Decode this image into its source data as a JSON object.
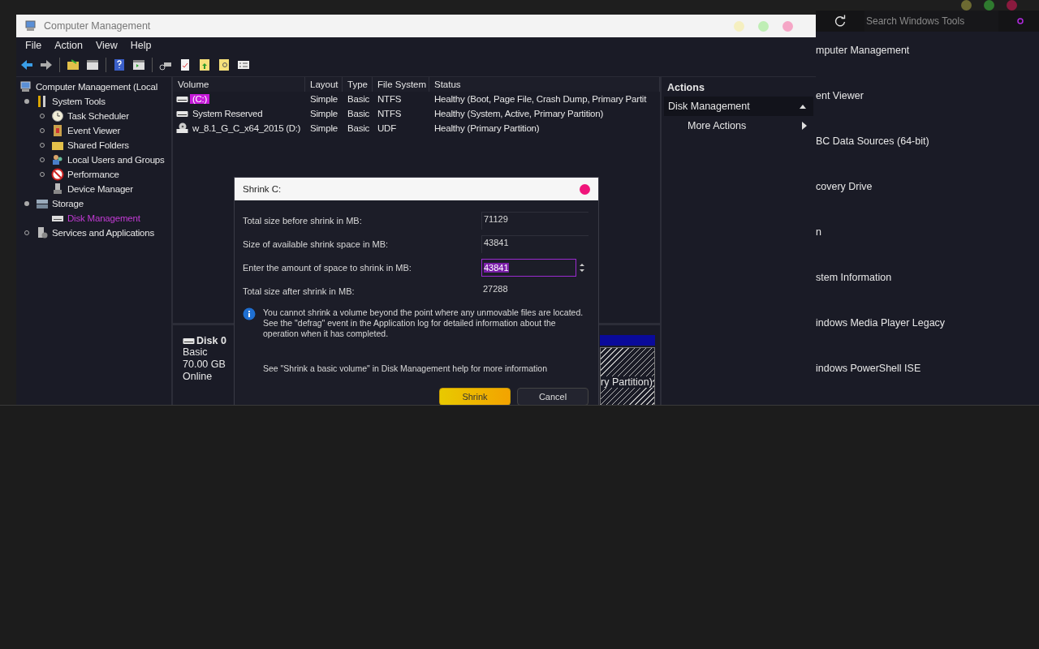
{
  "tools_window": {
    "search": {
      "placeholder": "Search Windows Tools"
    },
    "items": [
      "mputer Management",
      "ent Viewer",
      "BC Data Sources (64-bit)",
      "covery Drive",
      "n",
      "stem Information",
      "indows Media Player Legacy",
      "indows PowerShell ISE"
    ]
  },
  "window": {
    "title": "Computer Management"
  },
  "menu": [
    "File",
    "Action",
    "View",
    "Help"
  ],
  "tree": [
    {
      "label": "Computer Management (Local",
      "selected": false,
      "children": [
        {
          "label": "System Tools",
          "expanded": true,
          "selected": false,
          "children": [
            {
              "label": "Task Scheduler",
              "expanded": false,
              "selected": false
            },
            {
              "label": "Event Viewer",
              "expanded": false,
              "selected": false
            },
            {
              "label": "Shared Folders",
              "expanded": false,
              "selected": false
            },
            {
              "label": "Local Users and Groups",
              "expanded": false,
              "selected": false
            },
            {
              "label": "Performance",
              "expanded": false,
              "selected": false
            },
            {
              "label": "Device Manager",
              "selected": false
            }
          ]
        },
        {
          "label": "Storage",
          "expanded": true,
          "selected": false,
          "children": [
            {
              "label": "Disk Management",
              "selected": true
            }
          ]
        },
        {
          "label": "Services and Applications",
          "expanded": false,
          "selected": false
        }
      ]
    }
  ],
  "volumes": {
    "columns": [
      "Volume",
      "Layout",
      "Type",
      "File System",
      "Status"
    ],
    "rows": [
      {
        "kind": "disk",
        "selected": true,
        "cells": [
          "(C:)",
          "Simple",
          "Basic",
          "NTFS",
          "Healthy (Boot, Page File, Crash Dump, Primary Partit"
        ]
      },
      {
        "kind": "disk",
        "selected": false,
        "cells": [
          "System Reserved",
          "Simple",
          "Basic",
          "NTFS",
          "Healthy (System, Active, Primary Partition)"
        ]
      },
      {
        "kind": "optical",
        "selected": false,
        "cells": [
          "w_8.1_G_C_x64_2015 (D:)",
          "Simple",
          "Basic",
          "UDF",
          "Healthy (Primary Partition)"
        ]
      }
    ]
  },
  "disk": {
    "name": "Disk 0",
    "lines": [
      "Basic",
      "70.00 GB",
      "Online"
    ],
    "partition_text": "ry Partition)"
  },
  "actions": {
    "title": "Actions",
    "sections": [
      {
        "label": "Disk Management",
        "expanded": true,
        "items": [
          "More Actions"
        ]
      }
    ]
  },
  "dialog": {
    "title": "Shrink C:",
    "fields": [
      {
        "kind": "readout",
        "label": "Total size before shrink in MB:",
        "value": "71129"
      },
      {
        "kind": "readout",
        "label": "Size of available shrink space in MB:",
        "value": "43841"
      },
      {
        "kind": "spinner",
        "label": "Enter the amount of space to shrink in MB:",
        "value": "43841",
        "selected": true
      },
      {
        "kind": "plain",
        "label": "Total size after shrink in MB:",
        "value": "27288"
      }
    ],
    "info": "You cannot shrink a volume beyond the point where any unmovable files are located. See the \"defrag\" event in the Application log for detailed information about the operation when it has completed.",
    "help": "See \"Shrink a basic volume\" in Disk Management help for more information",
    "buttons": [
      {
        "label": "Shrink",
        "kind": "primary"
      },
      {
        "label": "Cancel",
        "kind": "secondary"
      }
    ]
  }
}
